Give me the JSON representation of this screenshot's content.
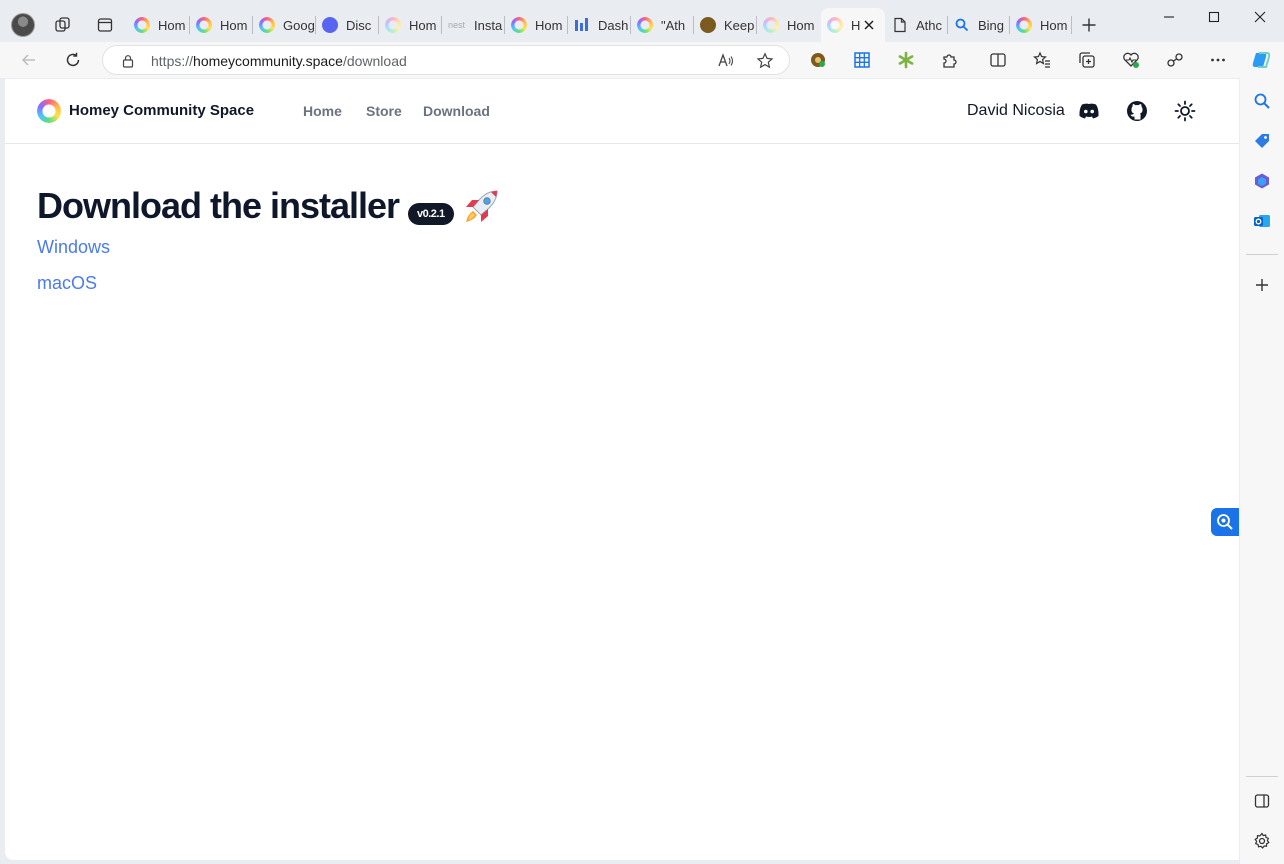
{
  "browser": {
    "tabs": [
      {
        "title": "Hom",
        "icon": "homey-icon"
      },
      {
        "title": "Hom",
        "icon": "homey-icon"
      },
      {
        "title": "Goog",
        "icon": "homey-icon"
      },
      {
        "title": "Disc",
        "icon": "discord-icon"
      },
      {
        "title": "Hom",
        "icon": "homey-icon"
      },
      {
        "title": "Insta",
        "icon": "nest-icon",
        "icon_text": "nest"
      },
      {
        "title": "Hom",
        "icon": "homey-icon"
      },
      {
        "title": "Dash",
        "icon": "dashboard-icon"
      },
      {
        "title": "\"Ath",
        "icon": "homey-icon"
      },
      {
        "title": "Keep",
        "icon": "keep-icon"
      },
      {
        "title": "Hom",
        "icon": "homey-icon"
      },
      {
        "title": "H",
        "icon": "homey-icon",
        "active": true
      },
      {
        "title": "Athc",
        "icon": "page-icon"
      },
      {
        "title": "Bing",
        "icon": "search-icon"
      },
      {
        "title": "Hom",
        "icon": "homey-icon"
      }
    ],
    "url_scheme": "https://",
    "url_host": "homeycommunity.space",
    "url_path": "/download"
  },
  "site": {
    "brand": "Homey Community Space",
    "nav": {
      "home": "Home",
      "store": "Store",
      "download": "Download"
    },
    "user_name": "David Nicosia"
  },
  "main": {
    "title": "Download the installer",
    "version": "v0.2.1",
    "links": {
      "windows": "Windows",
      "macos": "macOS"
    }
  },
  "colors": {
    "link": "#4b7bec",
    "badge_bg": "#111827",
    "accent": "#1a73e8"
  }
}
